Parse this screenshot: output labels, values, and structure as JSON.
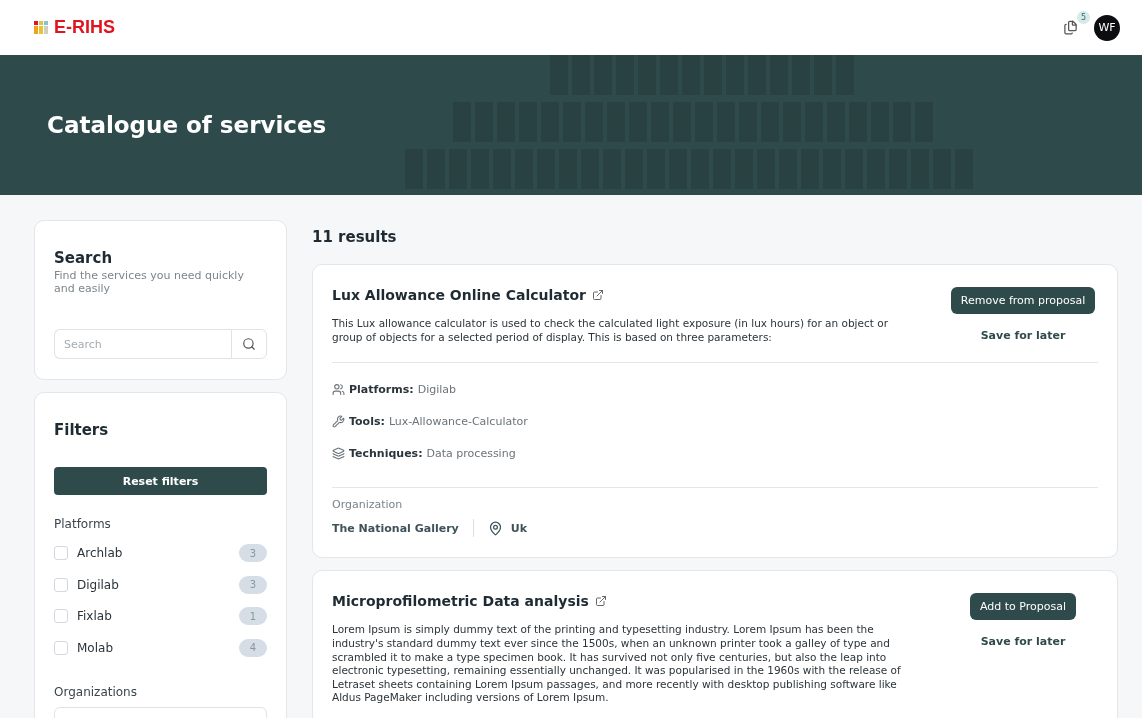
{
  "header": {
    "logo": "E-RIHS",
    "proposal_count": "5",
    "avatar": "WF"
  },
  "banner": {
    "title": "Catalogue of services"
  },
  "search": {
    "title": "Search",
    "subtitle": "Find the services you need quickly and easily",
    "placeholder": "Search"
  },
  "filters": {
    "title": "Filters",
    "reset": "Reset filters",
    "platforms_label": "Platforms",
    "platforms": [
      {
        "label": "Archlab",
        "count": "3",
        "checked": false
      },
      {
        "label": "Digilab",
        "count": "3",
        "checked": false
      },
      {
        "label": "Fixlab",
        "count": "1",
        "checked": false
      },
      {
        "label": "Molab",
        "count": "4",
        "checked": false
      }
    ],
    "organizations_label": "Organizations"
  },
  "results": {
    "count": "11 results",
    "items": [
      {
        "title": "Lux Allowance Online Calculator",
        "description": "This Lux allowance calculator is used to check the calculated light exposure (in lux hours) for an object or group of objects for a selected period of display. This is based on three parameters:",
        "action": "Remove from proposal",
        "save": "Save for later",
        "details": [
          {
            "kind": "platforms",
            "label": "Platforms:",
            "value": "Digilab"
          },
          {
            "kind": "tools",
            "label": "Tools:",
            "value": "Lux-Allowance-Calculator"
          },
          {
            "kind": "techniques",
            "label": "Techniques:",
            "value": "Data processing"
          }
        ],
        "organization_label": "Organization",
        "organization": "The National Gallery",
        "country": "Uk"
      },
      {
        "title": "Microprofilometric Data analysis",
        "description": "Lorem Ipsum is simply dummy text of the printing and typesetting industry. Lorem Ipsum has been the industry's standard dummy text ever since the 1500s, when an unknown printer took a galley of type and scrambled it to make a type specimen book. It has survived not only five centuries, but also the leap into electronic typesetting, remaining essentially unchanged. It was popularised in the 1960s with the release of Letraset sheets containing Lorem Ipsum passages, and more recently with desktop publishing software like Aldus PageMaker including versions of Lorem Ipsum.",
        "action": "Add to Proposal",
        "save": "Save for later"
      }
    ]
  }
}
